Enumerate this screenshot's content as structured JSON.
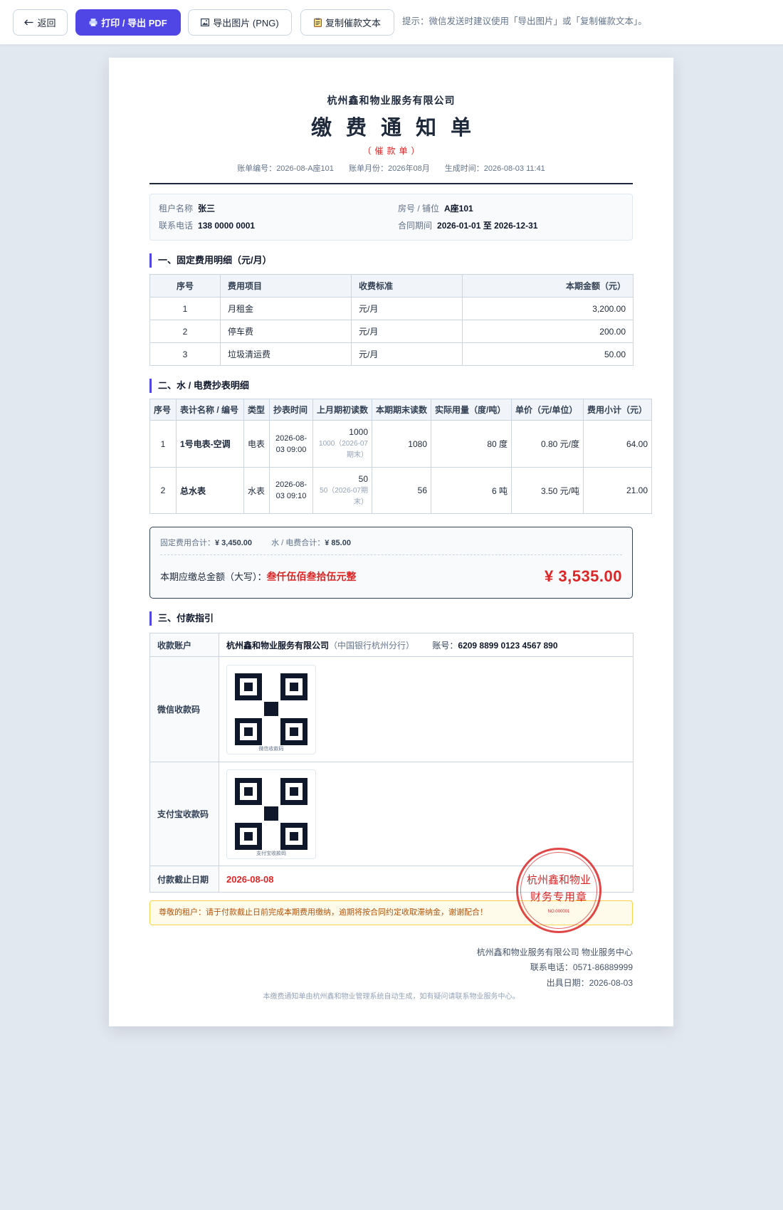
{
  "toolbar": {
    "back": {
      "icon": "arrow-left-icon",
      "label": "返回"
    },
    "print": {
      "icon": "printer-icon",
      "label": "打印 / 导出 PDF"
    },
    "export_png": {
      "icon": "image-icon",
      "label": "导出图片 (PNG)"
    },
    "copy_text": {
      "icon": "clipboard-icon",
      "label": "复制催款文本"
    },
    "hint": "提示：微信发送时建议使用「导出图片」或「复制催款文本」。"
  },
  "header": {
    "company": "杭州鑫和物业服务有限公司",
    "title": "缴费通知单",
    "subtitle": "（催款单）",
    "meta": [
      {
        "label": "账单编号：",
        "value": "2026-08-A座101"
      },
      {
        "label": "账单月份：",
        "value": "2026年08月"
      },
      {
        "label": "生成时间：",
        "value": "2026-08-03 11:41"
      }
    ]
  },
  "tenant_info": {
    "tenant": {
      "label": "租户名称",
      "value": "张三"
    },
    "room": {
      "label": "房号 / 铺位",
      "value": "A座101"
    },
    "phone": {
      "label": "联系电话",
      "value": "138 0000 0001"
    },
    "contract": {
      "label": "合同期间",
      "value": "2026-01-01 至 2026-12-31"
    }
  },
  "fixed_fees": {
    "title": "一、固定费用明细（元/月）",
    "headers": [
      "序号",
      "费用项目",
      "收费标准",
      "本期金额（元）"
    ],
    "rows": [
      {
        "no": "1",
        "item": "月租金",
        "unit": "元/月",
        "amount": "3,200.00"
      },
      {
        "no": "2",
        "item": "停车费",
        "unit": "元/月",
        "amount": "200.00"
      },
      {
        "no": "3",
        "item": "垃圾清运费",
        "unit": "元/月",
        "amount": "50.00"
      }
    ]
  },
  "meters": {
    "title": "二、水 / 电费抄表明细",
    "headers": [
      "序号",
      "表计名称 / 编号",
      "类型",
      "抄表时间",
      "上月期初读数",
      "本期期末读数",
      "实际用量（度/吨）",
      "单价（元/单位）",
      "费用小计（元）"
    ],
    "rows": [
      {
        "no": "1",
        "name": "1号电表-空调",
        "type": "电表",
        "time": "2026-08-03 09:00",
        "prev": "1000",
        "prev_note": "1000（2026-07期末）",
        "curr": "1080",
        "usage": "80 度",
        "price": "0.80 元/度",
        "subtotal": "64.00"
      },
      {
        "no": "2",
        "name": "总水表",
        "type": "水表",
        "time": "2026-08-03 09:10",
        "prev": "50",
        "prev_note": "50（2026-07期末）",
        "curr": "56",
        "usage": "6 吨",
        "price": "3.50 元/吨",
        "subtotal": "21.00"
      }
    ]
  },
  "totals": {
    "fixed_label": "固定费用合计：",
    "fixed_value": "¥ 3,450.00",
    "utility_label": "水 / 电费合计：",
    "utility_value": "¥ 85.00",
    "words_label": "本期应缴总金额（大写）：",
    "words_value": "叁仟伍佰叁拾伍元整",
    "amount": "¥ 3,535.00"
  },
  "payment": {
    "title": "三、付款指引",
    "account": {
      "label": "收款账户",
      "name": "杭州鑫和物业服务有限公司",
      "bank": "（中国银行杭州分行）",
      "number_label": "账号：",
      "number": "6209 8899 0123 4567 890"
    },
    "wechat": {
      "label": "微信收款码",
      "caption": "微信收款码",
      "icon": "qr-code-icon"
    },
    "alipay": {
      "label": "支付宝收款码",
      "caption": "支付宝收款码",
      "icon": "qr-code-icon"
    },
    "deadline": {
      "label": "付款截止日期",
      "value": "2026-08-08"
    }
  },
  "stamp": {
    "line1": "杭州鑫和物业",
    "line2": "财务专用章",
    "serial": "NO.000001"
  },
  "reminder": "尊敬的租户：请于付款截止日前完成本期费用缴纳，逾期将按合同约定收取滞纳金，谢谢配合！",
  "footer": {
    "issuer": "杭州鑫和物业服务有限公司 物业服务中心",
    "phone_label": "联系电话：",
    "phone": "0571-86889999",
    "date_label": "出具日期：",
    "date": "2026-08-03",
    "note": "本缴费通知单由杭州鑫和物业管理系统自动生成，如有疑问请联系物业服务中心。"
  },
  "colors": {
    "accent": "#4f46e5",
    "danger": "#dc2626",
    "text": "#1e293b",
    "page_background": "#e2e8f0",
    "paper": "#ffffff",
    "warning_background": "#fffbeb"
  }
}
